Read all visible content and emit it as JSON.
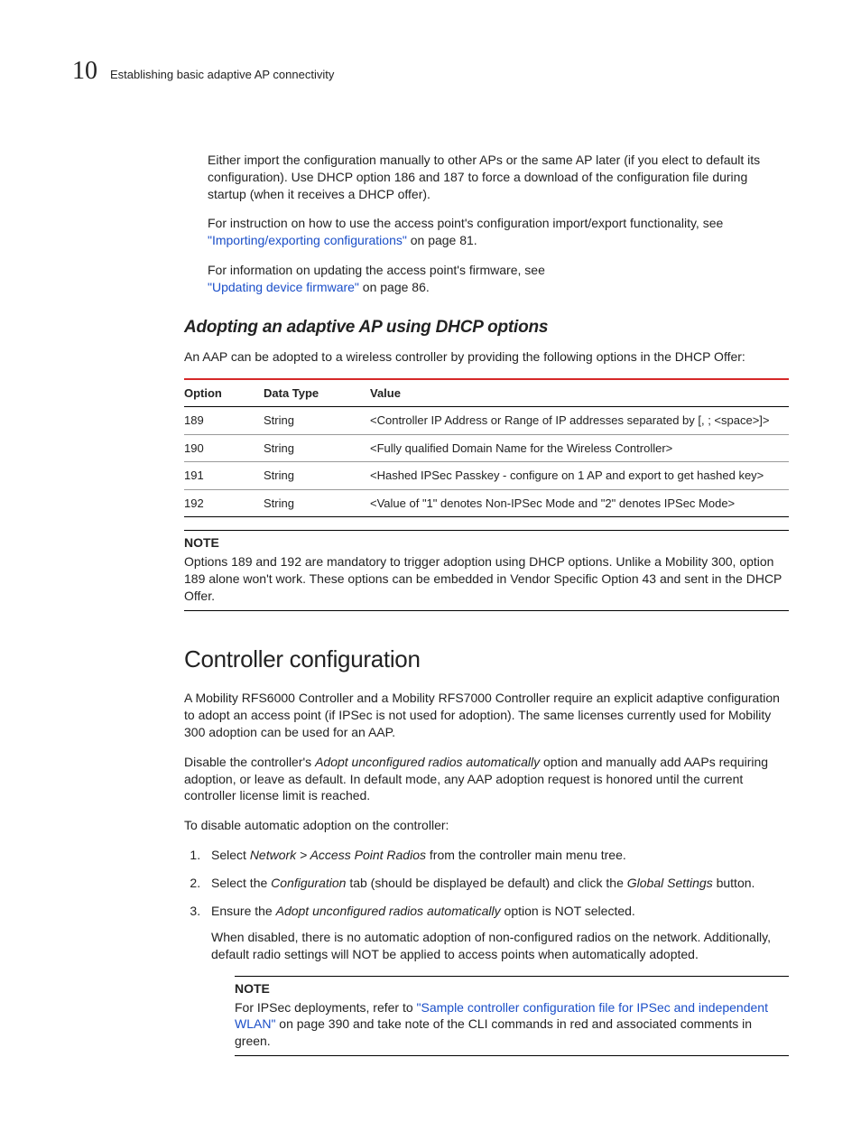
{
  "header": {
    "chapter_number": "10",
    "chapter_title": "Establishing basic adaptive AP connectivity"
  },
  "intro": {
    "p1": "Either import the configuration manually to other APs or the same AP later (if you elect to default its configuration). Use DHCP option 186 and 187 to force a download of the configuration file during startup (when it receives a DHCP offer).",
    "p2a": "For instruction on how to use the access point's configuration import/export functionality, see ",
    "p2_link": "\"Importing/exporting configurations\"",
    "p2b": " on page 81.",
    "p3a": "For information on updating the access point's firmware, see ",
    "p3_link": "\"Updating device firmware\"",
    "p3b": " on page 86."
  },
  "adopt": {
    "heading": "Adopting an adaptive AP using DHCP options",
    "intro": "An AAP can be adopted to a wireless controller by providing the following options in the DHCP Offer:",
    "table": {
      "headers": {
        "c1": "Option",
        "c2": "Data Type",
        "c3": "Value"
      },
      "rows": [
        {
          "opt": "189",
          "dt": "String",
          "val": "<Controller IP Address or Range of IP addresses separated by [, ; <space>]>"
        },
        {
          "opt": "190",
          "dt": "String",
          "val": "<Fully qualified Domain Name for the Wireless Controller>"
        },
        {
          "opt": "191",
          "dt": "String",
          "val": "<Hashed IPSec Passkey - configure on 1 AP and export to get hashed key>"
        },
        {
          "opt": "192",
          "dt": "String",
          "val": "<Value of \"1\" denotes Non-IPSec Mode and \"2\" denotes IPSec Mode>"
        }
      ]
    },
    "note": {
      "head": "NOTE",
      "body": "Options 189 and 192 are mandatory to trigger adoption using DHCP options. Unlike a Mobility 300, option 189 alone won't work. These options can be embedded in Vendor Specific Option 43 and sent in the DHCP Offer."
    }
  },
  "ctrl": {
    "heading": "Controller configuration",
    "p1": "A Mobility RFS6000 Controller and a Mobility RFS7000 Controller require an explicit adaptive configuration to adopt an access point (if IPSec is not used for adoption). The same licenses currently used for Mobility 300 adoption can be used for an AAP.",
    "p2a": "Disable the controller's ",
    "p2_em": "Adopt unconfigured radios automatically",
    "p2b": " option and manually add AAPs requiring adoption, or leave as default. In default mode, any AAP adoption request is honored until the current controller license limit is reached.",
    "p3": "To disable automatic adoption on the controller:",
    "steps": {
      "s1a": "Select ",
      "s1_em": "Network > Access Point Radios",
      "s1b": " from the controller main menu tree.",
      "s2a": "Select the ",
      "s2_em1": "Configuration",
      "s2b": " tab (should be displayed be default) and click the ",
      "s2_em2": "Global Settings",
      "s2c": " button.",
      "s3a": "Ensure the ",
      "s3_em": "Adopt unconfigured radios automatically",
      "s3b": " option is NOT selected.",
      "s3_extra": "When disabled, there is no automatic adoption of non-configured radios on the network. Additionally, default radio settings will NOT be applied to access points when automatically adopted."
    },
    "note2": {
      "head": "NOTE",
      "body_a": "For IPSec deployments, refer to ",
      "link": "\"Sample controller configuration file for IPSec and independent WLAN\"",
      "body_b": " on page 390 and take note of the CLI commands in red and associated comments in green."
    }
  }
}
